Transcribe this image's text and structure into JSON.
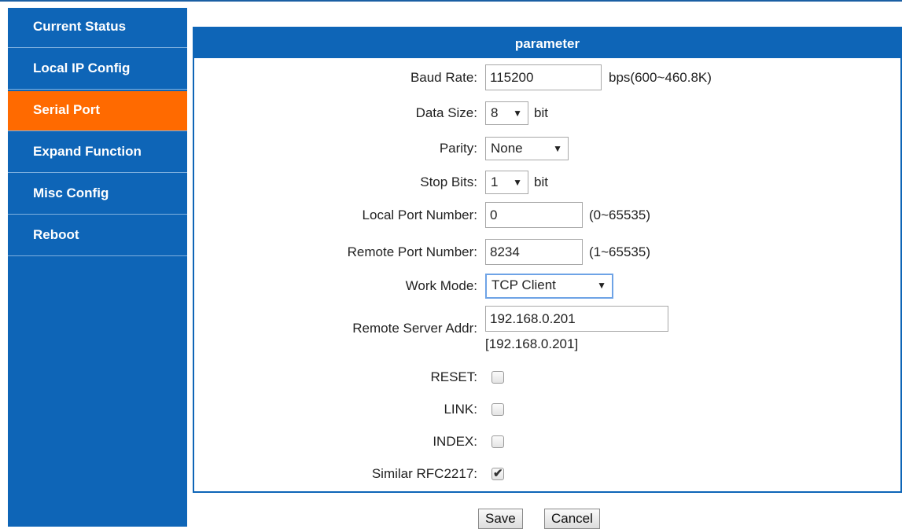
{
  "sidebar": {
    "items": [
      {
        "label": "Current Status"
      },
      {
        "label": "Local IP Config"
      },
      {
        "label": "Serial Port"
      },
      {
        "label": "Expand Function"
      },
      {
        "label": "Misc Config"
      },
      {
        "label": "Reboot"
      }
    ],
    "active_index": 2
  },
  "panel": {
    "title": "parameter",
    "baud_rate": {
      "label": "Baud Rate:",
      "value": "115200",
      "suffix": "bps(600~460.8K)"
    },
    "data_size": {
      "label": "Data Size:",
      "value": "8",
      "suffix": "bit"
    },
    "parity": {
      "label": "Parity:",
      "value": "None"
    },
    "stop_bits": {
      "label": "Stop Bits:",
      "value": "1",
      "suffix": "bit"
    },
    "local_port": {
      "label": "Local Port Number:",
      "value": "0",
      "suffix": "(0~65535)"
    },
    "remote_port": {
      "label": "Remote Port Number:",
      "value": "8234",
      "suffix": "(1~65535)"
    },
    "work_mode": {
      "label": "Work Mode:",
      "value": "TCP Client"
    },
    "remote_server": {
      "label": "Remote Server Addr:",
      "value": "192.168.0.201",
      "resolved": "[192.168.0.201]"
    },
    "reset": {
      "label": "RESET:",
      "checked": false
    },
    "link": {
      "label": "LINK:",
      "checked": false
    },
    "index": {
      "label": "INDEX:",
      "checked": false
    },
    "rfc2217": {
      "label": "Similar RFC2217:",
      "checked": true
    }
  },
  "buttons": {
    "save": "Save",
    "cancel": "Cancel"
  },
  "icons": {
    "dropdown": "caret-down-icon",
    "check": "check-icon"
  },
  "colors": {
    "nav_bg": "#0e65b7",
    "nav_active": "#ff6a00",
    "header_bg": "#0e65b7"
  }
}
